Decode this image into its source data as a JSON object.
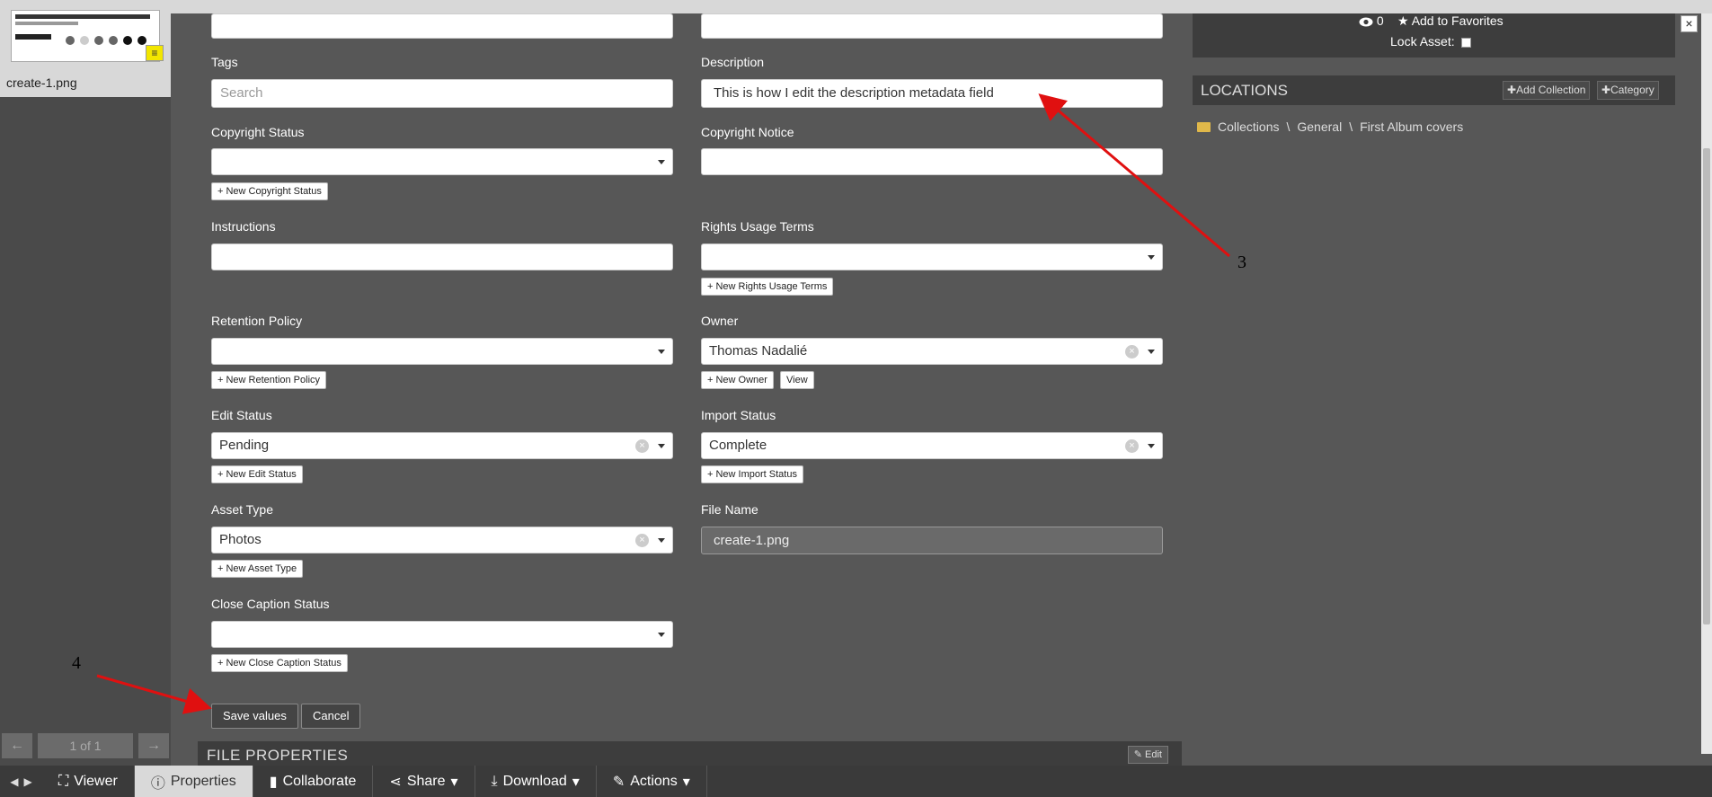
{
  "sidebar": {
    "thumbnail_name": "create-1.png",
    "pager": {
      "info": "1 of 1"
    }
  },
  "form": {
    "tags": {
      "label": "Tags",
      "placeholder": "Search"
    },
    "description": {
      "label": "Description",
      "value": "This is how I edit the description metadata field"
    },
    "copyright_status": {
      "label": "Copyright Status",
      "new_button": "+ New Copyright Status"
    },
    "copyright_notice": {
      "label": "Copyright Notice"
    },
    "instructions": {
      "label": "Instructions"
    },
    "rights_usage_terms": {
      "label": "Rights Usage Terms",
      "new_button": "+ New Rights Usage Terms"
    },
    "retention_policy": {
      "label": "Retention Policy",
      "new_button": "+ New Retention Policy"
    },
    "owner": {
      "label": "Owner",
      "value": "Thomas Nadalié",
      "new_button": "+ New Owner",
      "view_button": "View"
    },
    "edit_status": {
      "label": "Edit Status",
      "value": "Pending",
      "new_button": "+ New Edit Status"
    },
    "import_status": {
      "label": "Import Status",
      "value": "Complete",
      "new_button": "+ New Import Status"
    },
    "asset_type": {
      "label": "Asset Type",
      "value": "Photos",
      "new_button": "+ New Asset Type"
    },
    "file_name": {
      "label": "File Name",
      "value": "create-1.png"
    },
    "close_caption_status": {
      "label": "Close Caption Status",
      "new_button": "+ New Close Caption Status"
    },
    "save_label": "Save values",
    "cancel_label": "Cancel",
    "file_properties": {
      "title": "FILE PROPERTIES",
      "edit_label": "Edit"
    }
  },
  "right_panel": {
    "views": "0",
    "add_to_favorites": "Add to Favorites",
    "lock_asset": "Lock Asset:",
    "locations": {
      "title": "LOCATIONS",
      "add_collection": "Add Collection",
      "add_category": "Category",
      "breadcrumb": [
        "Collections",
        "General",
        "First Album covers"
      ]
    }
  },
  "toolbar": {
    "tabs": [
      "Viewer",
      "Properties",
      "Collaborate",
      "Share",
      "Download",
      "Actions"
    ],
    "active_tab": "Properties"
  },
  "annotations": {
    "arrow_3": "3",
    "arrow_4": "4"
  },
  "colors": {
    "background": "#575757",
    "panel": "#3d3d3d",
    "arrow": "#e01010",
    "folder": "#e0b84a"
  },
  "icons": [
    "eye-icon",
    "star-icon",
    "plus-icon",
    "folder-icon",
    "close-icon",
    "expand-icon",
    "info-icon",
    "comment-icon",
    "share-icon",
    "download-icon",
    "edit-icon",
    "arrow-left-icon",
    "arrow-right-icon"
  ]
}
